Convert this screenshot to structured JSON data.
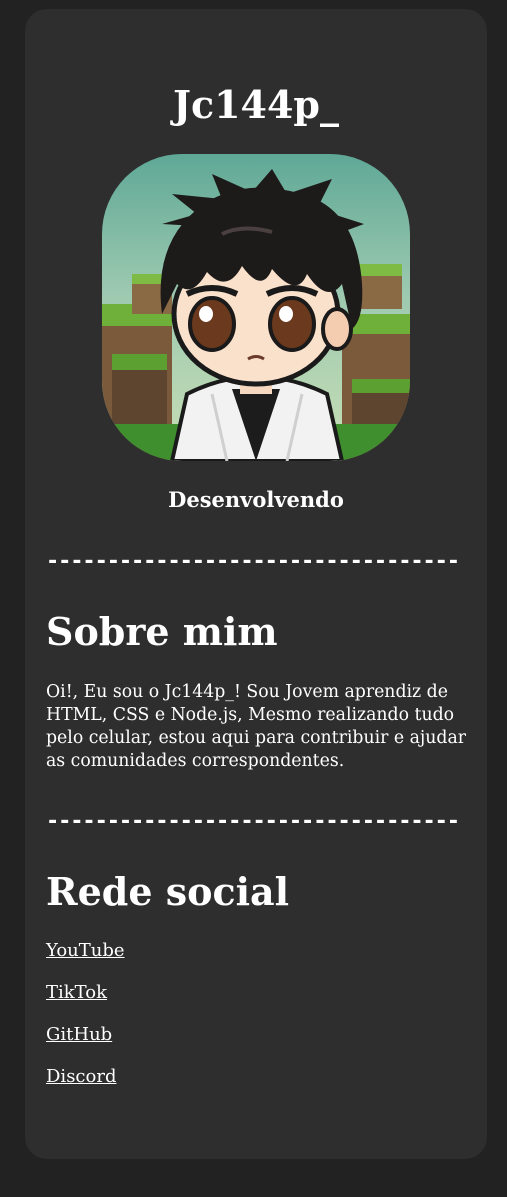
{
  "profile": {
    "username": "Jc144p_",
    "status": "Desenvolvendo",
    "avatar_icon": "chibi-avatar-minecraft-background"
  },
  "dividers": {
    "first": "----------------------------------",
    "second": "----------------------------------"
  },
  "about": {
    "title": "Sobre mim",
    "text": "Oi!, Eu sou o Jc144p_! Sou Jovem aprendiz de HTML, CSS e Node.js, Mesmo realizando tudo pelo celular, estou aqui para contribuir e ajudar as comunidades correspondentes."
  },
  "social": {
    "title": "Rede social",
    "links": [
      "YouTube",
      "TikTok",
      "GitHub",
      "Discord"
    ]
  },
  "colors": {
    "page_background": "#222222",
    "card_background": "#2e2e2e",
    "text": "#ffffff"
  }
}
